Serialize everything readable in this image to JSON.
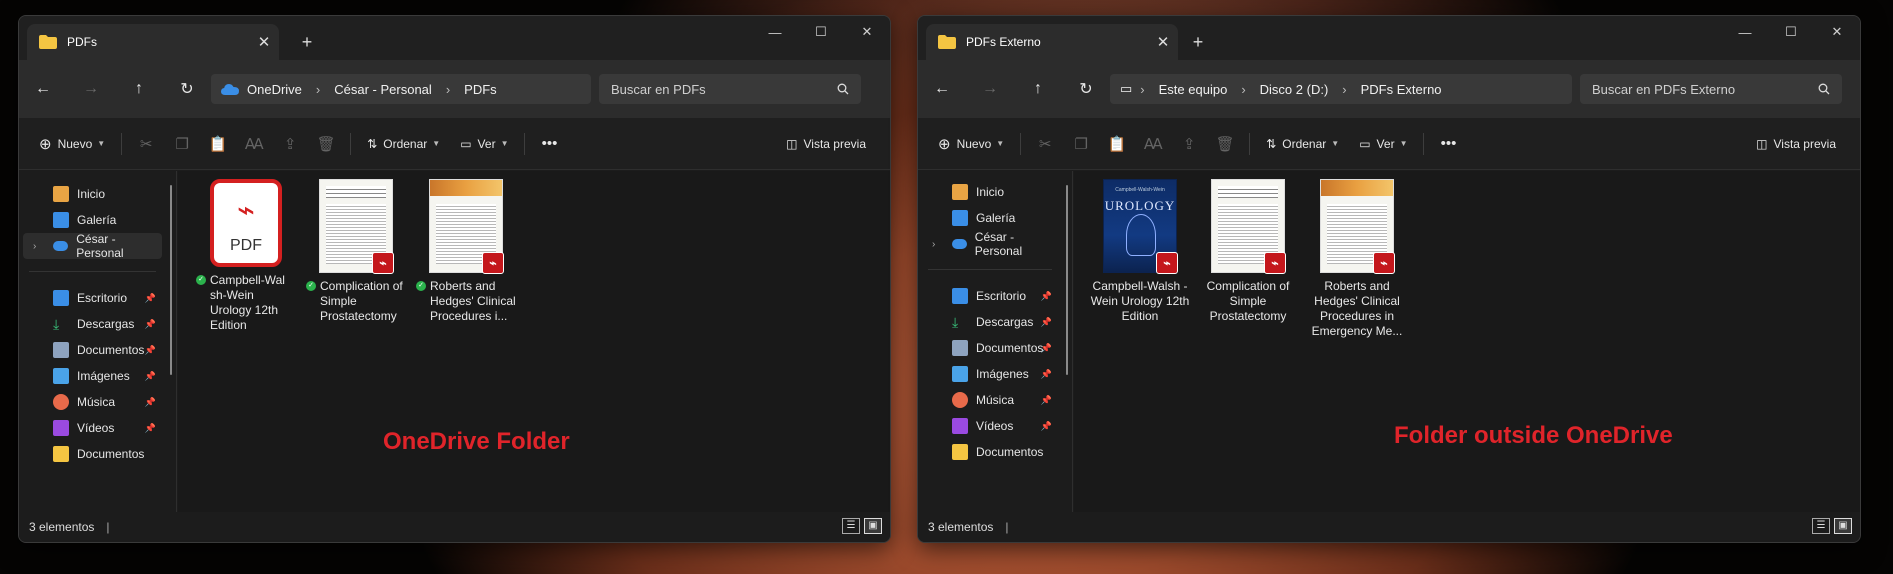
{
  "colors": {
    "accent": "#e0242a",
    "folder_yellow": "#f4c542",
    "onedrive_blue": "#3a8ee6",
    "sync_green": "#2bb24c",
    "pdf_red": "#c4171c"
  },
  "left": {
    "tab_title": "PDFs",
    "breadcrumb": [
      "OneDrive",
      "César - Personal",
      "PDFs"
    ],
    "search_placeholder": "Buscar en PDFs",
    "toolbar": {
      "new": "Nuevo",
      "sort": "Ordenar",
      "view": "Ver",
      "preview": "Vista previa"
    },
    "sidebar": [
      {
        "label": "Inicio",
        "icon": "home-icon"
      },
      {
        "label": "Galería",
        "icon": "gallery-icon"
      },
      {
        "label": "César - Personal",
        "icon": "onedrive-cloud-icon"
      },
      {
        "label": "Escritorio",
        "icon": "desktop-icon"
      },
      {
        "label": "Descargas",
        "icon": "download-icon"
      },
      {
        "label": "Documentos",
        "icon": "documents-icon"
      },
      {
        "label": "Imágenes",
        "icon": "pictures-icon"
      },
      {
        "label": "Música",
        "icon": "music-icon"
      },
      {
        "label": "Vídeos",
        "icon": "videos-icon"
      },
      {
        "label": "Documentos",
        "icon": "folder-icon"
      }
    ],
    "files": [
      {
        "name": "Campbell-Walsh-Wein Urology 12th Edition",
        "display": "Campbell-Wal sh-Wein Urology 12th Edition",
        "thumb": "pdf-generic",
        "synced": true
      },
      {
        "name": "Complication of Simple Prostatectomy",
        "display": "Complication of Simple Prostatectomy",
        "thumb": "article",
        "synced": true
      },
      {
        "name": "Roberts and Hedges' Clinical Procedures i...",
        "display": "Roberts and Hedges' Clinical Procedures i...",
        "thumb": "article-color",
        "synced": true
      }
    ],
    "status": "3 elementos",
    "pdf_label": "PDF"
  },
  "right": {
    "tab_title": "PDFs Externo",
    "breadcrumb": [
      "Este equipo",
      "Disco 2 (D:)",
      "PDFs Externo"
    ],
    "search_placeholder": "Buscar en PDFs Externo",
    "toolbar": {
      "new": "Nuevo",
      "sort": "Ordenar",
      "view": "Ver",
      "preview": "Vista previa"
    },
    "sidebar": [
      {
        "label": "Inicio",
        "icon": "home-icon"
      },
      {
        "label": "Galería",
        "icon": "gallery-icon"
      },
      {
        "label": "César - Personal",
        "icon": "onedrive-cloud-icon"
      },
      {
        "label": "Escritorio",
        "icon": "desktop-icon"
      },
      {
        "label": "Descargas",
        "icon": "download-icon"
      },
      {
        "label": "Documentos",
        "icon": "documents-icon"
      },
      {
        "label": "Imágenes",
        "icon": "pictures-icon"
      },
      {
        "label": "Música",
        "icon": "music-icon"
      },
      {
        "label": "Vídeos",
        "icon": "videos-icon"
      },
      {
        "label": "Documentos",
        "icon": "folder-icon"
      }
    ],
    "files": [
      {
        "name": "Campbell-Walsh-Wein Urology 12th Edition",
        "display": "Campbell-Walsh -Wein Urology 12th Edition",
        "thumb": "book-cover",
        "synced": false
      },
      {
        "name": "Complication of Simple Prostatectomy",
        "display": "Complication of Simple Prostatectomy",
        "thumb": "article",
        "synced": false
      },
      {
        "name": "Roberts and Hedges' Clinical Procedures in Emergency Me...",
        "display": "Roberts and Hedges' Clinical Procedures in Emergency Me...",
        "thumb": "article-color",
        "synced": false
      }
    ],
    "status": "3 elementos",
    "book_title": "UROLOGY",
    "book_sub": "Campbell-Walsh-Wein"
  },
  "annotations": {
    "left": "OneDrive Folder",
    "right": "Folder outside OneDrive"
  }
}
